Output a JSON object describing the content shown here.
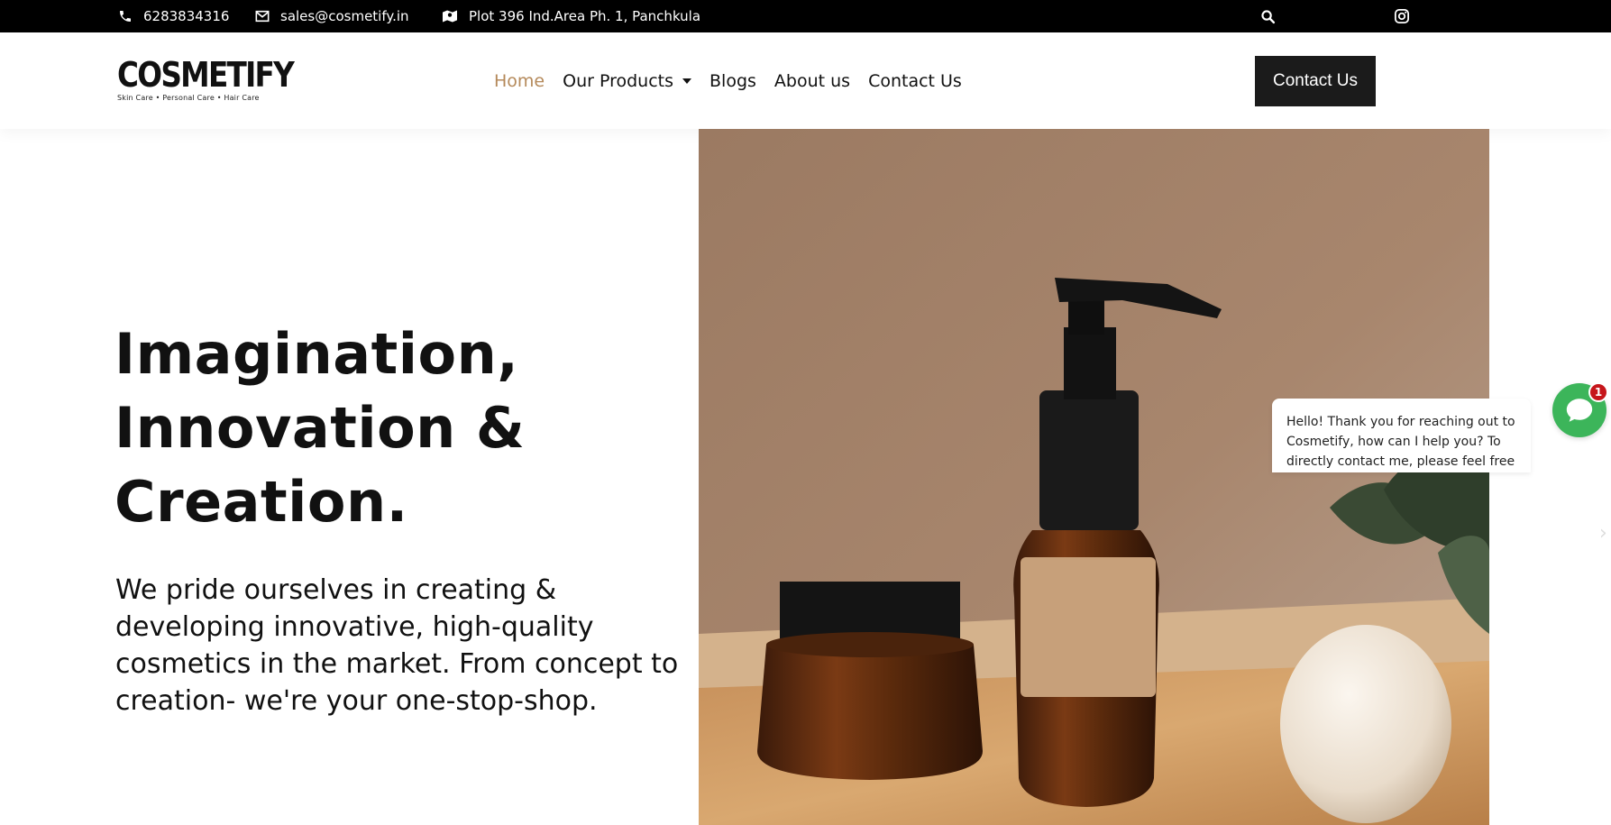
{
  "topbar": {
    "phone": "6283834316",
    "email": "sales@cosmetify.in",
    "address": "Plot 396 Ind.Area Ph. 1, Panchkula",
    "icons": [
      "phone-icon",
      "envelope-icon",
      "map-icon",
      "search-icon",
      "phone-icon",
      "facebook-icon",
      "instagram-icon"
    ]
  },
  "header": {
    "logo_text": "COSMETIFY",
    "logo_tagline": "Skin Care • Personal Care • Hair Care",
    "nav": [
      {
        "label": "Home",
        "active": true
      },
      {
        "label": "Our Products",
        "dropdown": true
      },
      {
        "label": "Blogs"
      },
      {
        "label": "About us"
      },
      {
        "label": "Contact Us"
      }
    ],
    "cta_label": "Contact Us"
  },
  "hero": {
    "title_line1": "Imagination,",
    "title_line2": "Innovation &",
    "title_line3": "Creation.",
    "description": "We pride ourselves in creating & developing innovative, high-quality cosmetics in the market. From concept to creation- we're your one-stop-shop."
  },
  "chat": {
    "message": "Hello! Thank you for reaching out to Cosmetify, how can I help you? To directly contact me, please feel free",
    "badge_count": "1"
  },
  "colors": {
    "topbar_bg": "#000000",
    "accent": "#b58a5b",
    "cta_bg": "#1b1b1b",
    "chat_green": "#3cb55a",
    "badge_red": "#c6161b"
  }
}
